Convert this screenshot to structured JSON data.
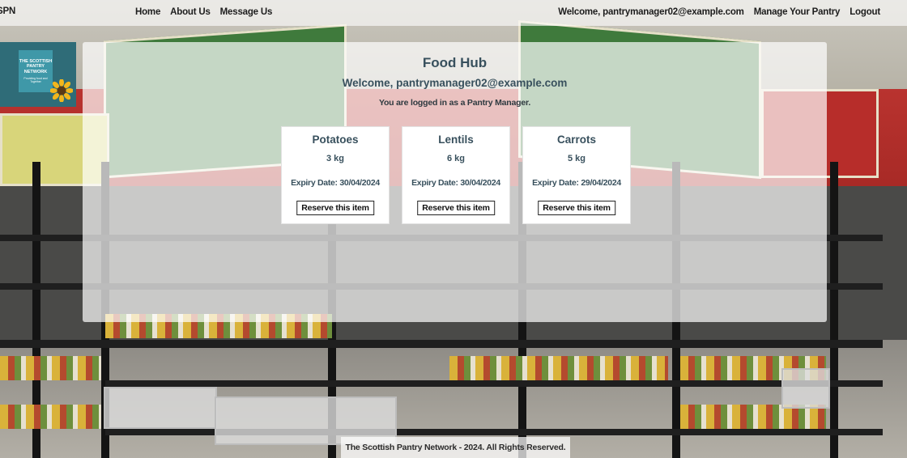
{
  "nav": {
    "brand": "SPN",
    "left_links": [
      "Home",
      "About Us",
      "Message Us"
    ],
    "welcome": "Welcome, pantrymanager02@example.com",
    "manage": "Manage Your Pantry",
    "logout": "Logout"
  },
  "logo": {
    "title": "THE SCOTTISH PANTRY NETWORK",
    "tagline": "Providing food and Together"
  },
  "hub": {
    "title": "Food Hub",
    "welcome": "Welcome, pantrymanager02@example.com",
    "role_note": "You are logged in as a Pantry Manager."
  },
  "items": [
    {
      "name": "Potatoes",
      "quantity": "3 kg",
      "expiry": "Expiry Date: 30/04/2024",
      "button": "Reserve this item"
    },
    {
      "name": "Lentils",
      "quantity": "6 kg",
      "expiry": "Expiry Date: 30/04/2024",
      "button": "Reserve this item"
    },
    {
      "name": "Carrots",
      "quantity": "5 kg",
      "expiry": "Expiry Date: 29/04/2024",
      "button": "Reserve this item"
    }
  ],
  "footer": "The Scottish Pantry Network - 2024. All Rights Reserved.",
  "colors": {
    "heading": "#38505d",
    "logo_bg": "#2f6c78"
  },
  "icons": [
    "sunflower-icon"
  ]
}
